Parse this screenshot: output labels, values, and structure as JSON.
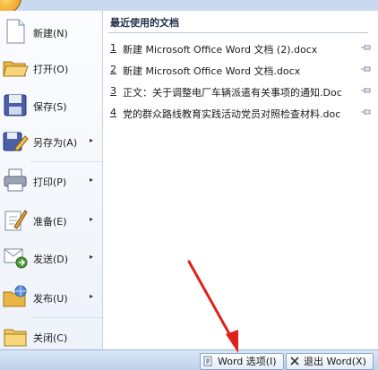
{
  "menu": {
    "items": [
      {
        "label": "新建(N)",
        "has_submenu": false,
        "icon": "new-document-icon"
      },
      {
        "label": "打开(O)",
        "has_submenu": false,
        "icon": "open-folder-icon"
      },
      {
        "label": "保存(S)",
        "has_submenu": false,
        "icon": "save-disk-icon"
      },
      {
        "label": "另存为(A)",
        "has_submenu": true,
        "icon": "save-as-icon"
      },
      {
        "label": "打印(P)",
        "has_submenu": true,
        "icon": "printer-icon"
      },
      {
        "label": "准备(E)",
        "has_submenu": true,
        "icon": "prepare-icon"
      },
      {
        "label": "发送(D)",
        "has_submenu": true,
        "icon": "send-icon"
      },
      {
        "label": "发布(U)",
        "has_submenu": true,
        "icon": "publish-icon"
      },
      {
        "label": "关闭(C)",
        "has_submenu": false,
        "icon": "close-folder-icon"
      }
    ],
    "submenu_arrow": "▸"
  },
  "recent": {
    "heading": "最近使用的文档",
    "documents": [
      {
        "num": "1",
        "name": "新建 Microsoft Office Word 文档 (2).docx"
      },
      {
        "num": "2",
        "name": "新建 Microsoft Office Word 文档.docx"
      },
      {
        "num": "3",
        "name": "正文：关于调整电厂车辆派遣有关事项的通知.Doc"
      },
      {
        "num": "4",
        "name": "党的群众路线教育实践活动党员对照检查材料.doc"
      }
    ]
  },
  "footer": {
    "options_label": "Word 选项(I)",
    "exit_label": "退出 Word(X)"
  },
  "colors": {
    "annotation_arrow": "#e0201a",
    "accent": "#1f4e96"
  }
}
